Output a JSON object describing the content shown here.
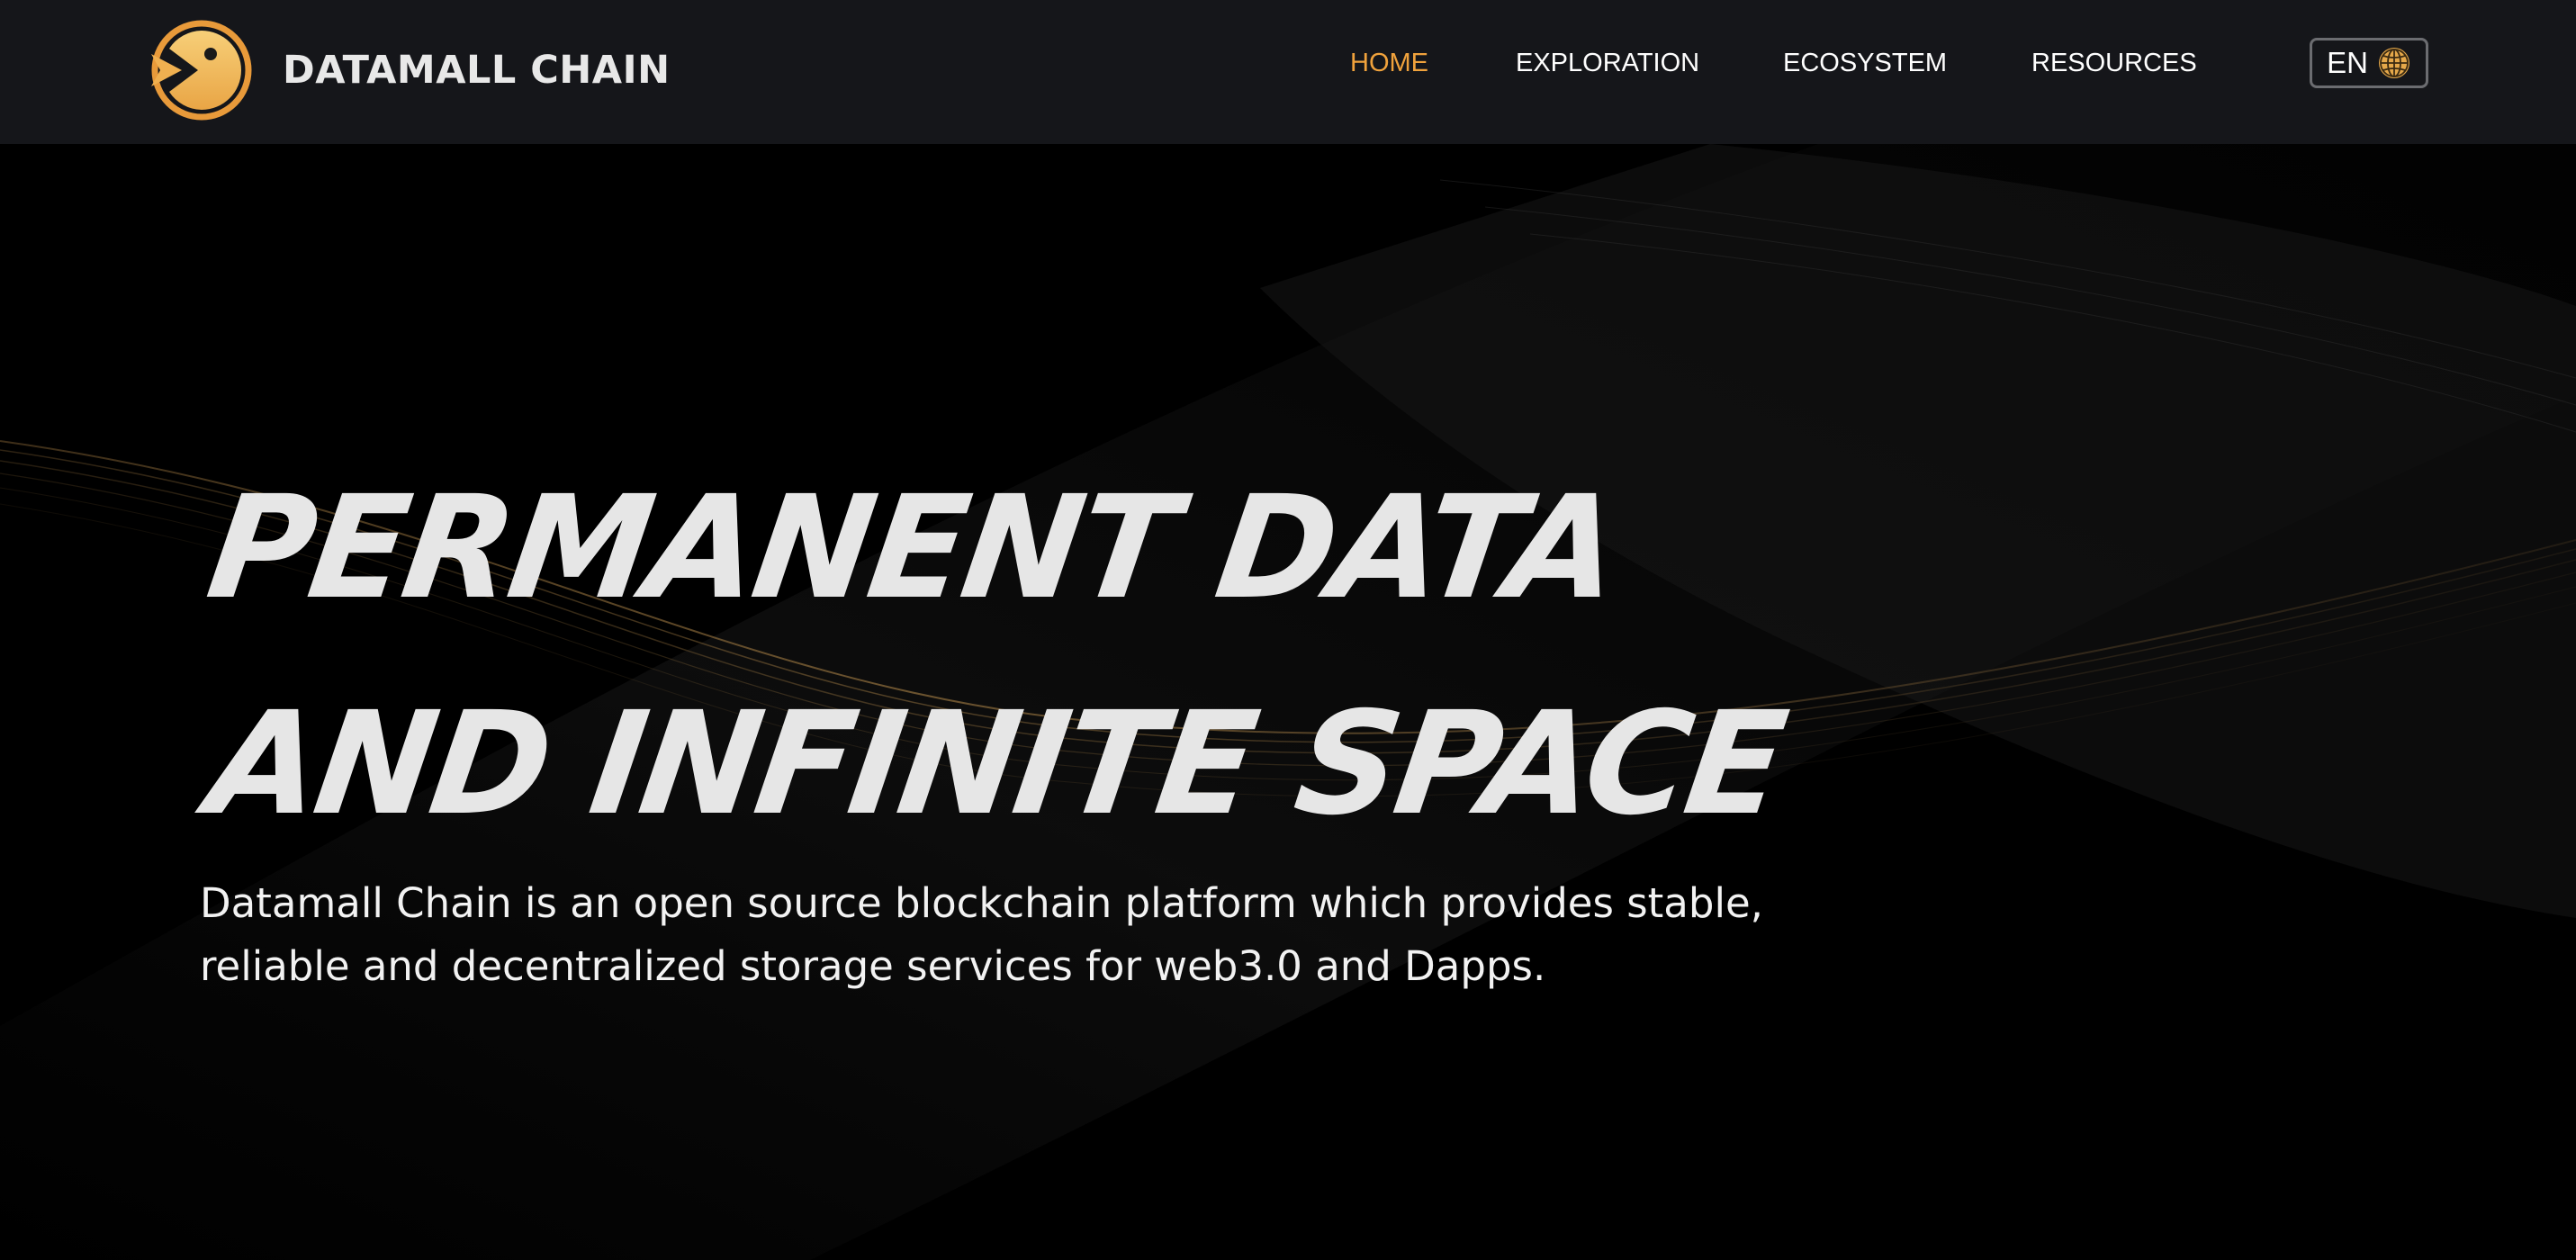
{
  "brand": {
    "name": "DATAMALL CHAIN",
    "logo_icon": "chevron-pac-logo-icon",
    "accent_color": "#f0a23c",
    "logo_color": "#f5c36a"
  },
  "nav": {
    "items": [
      {
        "label": "HOME",
        "active": true
      },
      {
        "label": "EXPLORATION",
        "active": false
      },
      {
        "label": "ECOSYSTEM",
        "active": false
      },
      {
        "label": "RESOURCES",
        "active": false
      }
    ],
    "language": {
      "label": "EN",
      "icon": "globe-icon"
    }
  },
  "hero": {
    "title_line_1": "PERMANENT DATA",
    "title_line_2": "AND INFINITE SPACE",
    "description_line_1": "Datamall Chain is an open source blockchain platform which provides stable,",
    "description_line_2": "reliable and decentralized storage services for web3.0 and Dapps."
  },
  "colors": {
    "header_bg": "#15161a",
    "page_bg": "#000000",
    "title": "#e6e6e6",
    "wave": "#8a6a3a"
  }
}
